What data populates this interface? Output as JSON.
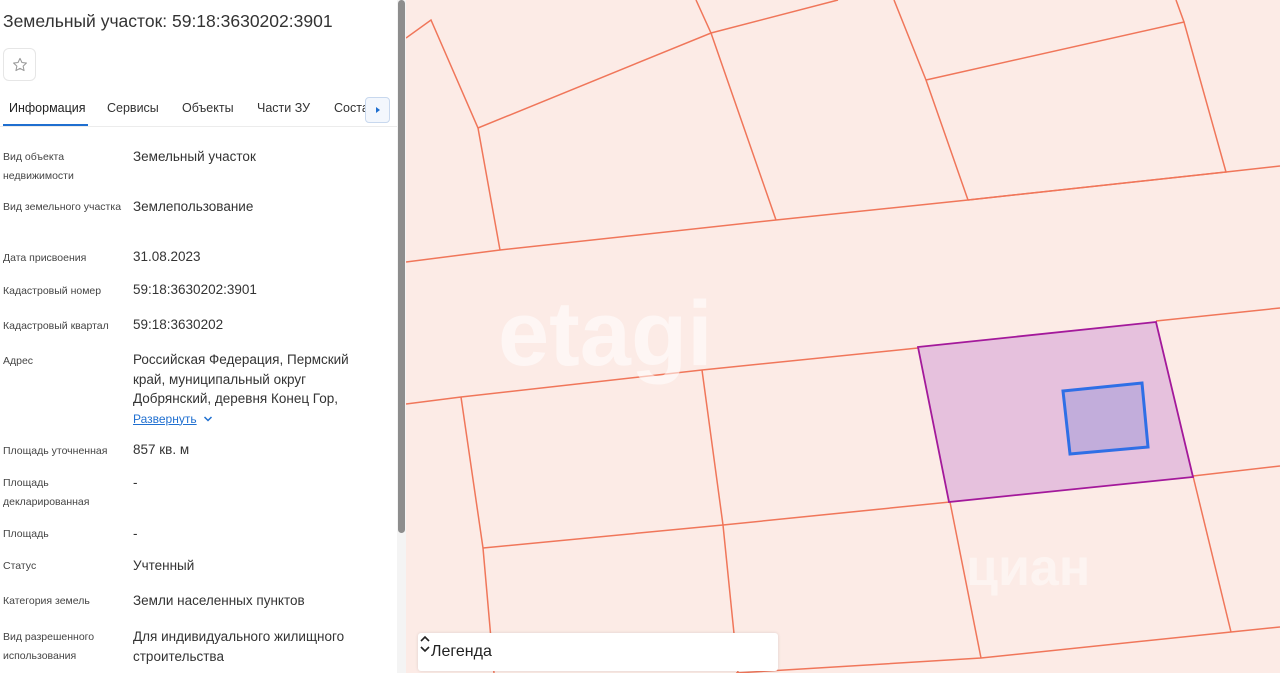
{
  "panel": {
    "title": "Земельный участок: 59:18:3630202:3901",
    "tabs": [
      {
        "label": "Информация"
      },
      {
        "label": "Сервисы"
      },
      {
        "label": "Объекты"
      },
      {
        "label": "Части ЗУ"
      },
      {
        "label": "Соста"
      }
    ],
    "details": [
      {
        "label": "Вид объекта недвижимости",
        "value": "Земельный участок"
      },
      {
        "label": "Вид земельного участка",
        "value": "Землепользование"
      },
      {
        "label": "Дата присвоения",
        "value": "31.08.2023"
      },
      {
        "label": "Кадастровый номер",
        "value": "59:18:3630202:3901"
      },
      {
        "label": "Кадастровый квартал",
        "value": "59:18:3630202"
      },
      {
        "label": "Адрес",
        "value": "Российская Федерация, Пермский край, муниципальный округ Добрянский, деревня Конец Гор,"
      },
      {
        "label": "Площадь уточненная",
        "value": "857 кв. м"
      },
      {
        "label": "Площадь декларированная",
        "value": "-"
      },
      {
        "label": "Площадь",
        "value": "-"
      },
      {
        "label": "Статус",
        "value": "Учтенный"
      },
      {
        "label": "Категория земель",
        "value": "Земли населенных пунктов"
      },
      {
        "label": "Вид разрешенного использования",
        "value": "Для индивидуального жилищного строительства"
      }
    ],
    "address_expand": "Развернуть"
  },
  "map": {
    "watermark_center": "etagi",
    "watermark_corner": "циан",
    "legend_label": "Легенда",
    "colors": {
      "background": "#fcebe6",
      "parcel_lines": "#f0765a",
      "selected_fill": "#e6c1dd",
      "selected_stroke": "#a3199b",
      "building_fill": "#c2addb",
      "building_stroke": "#2f6fe6"
    }
  },
  "icons": {
    "favorite": "star-outline-icon",
    "tabs_next": "caret-right-icon",
    "expand": "chevron-down-icon",
    "legend_toggle": "chevron-up-down-icon"
  }
}
